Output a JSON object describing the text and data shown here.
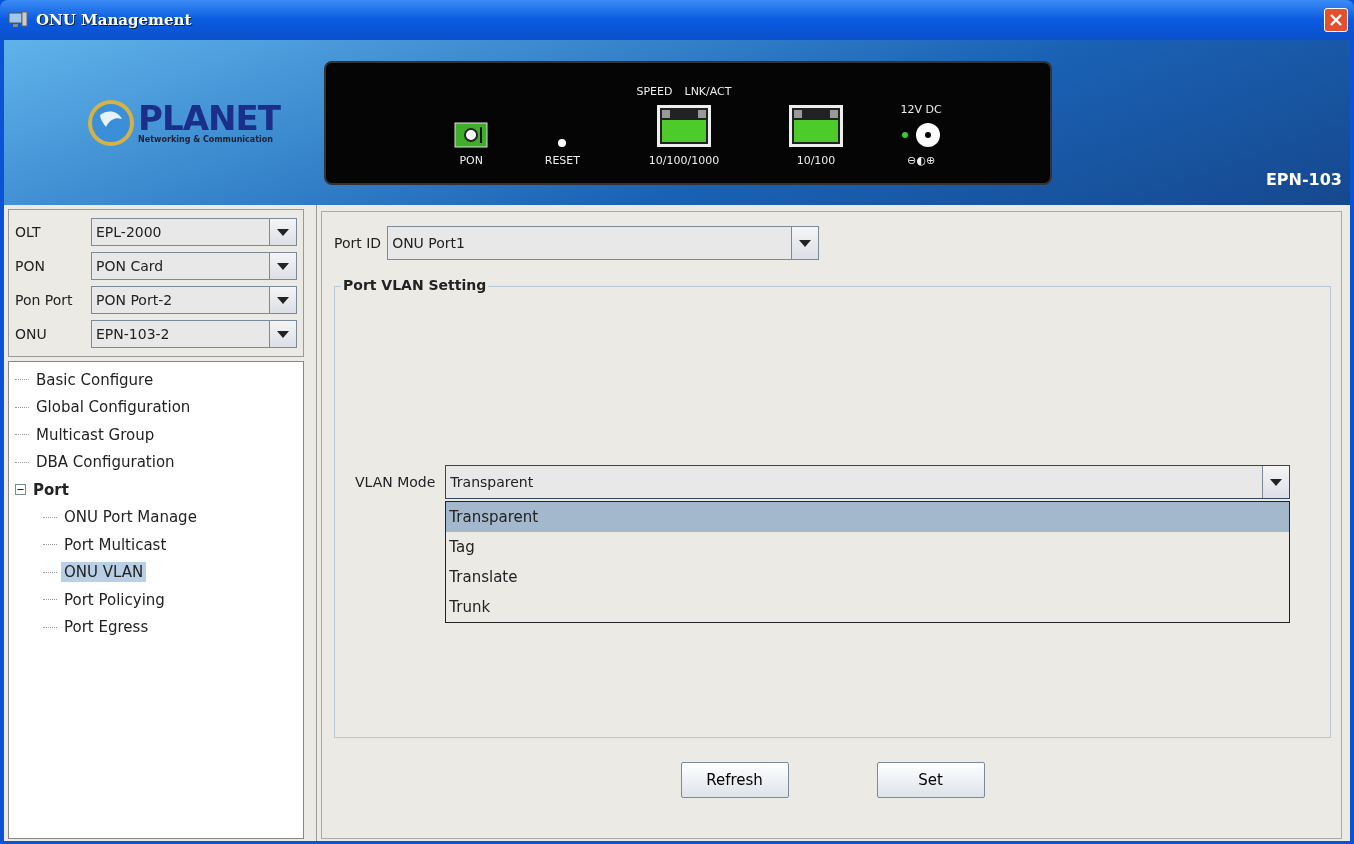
{
  "window": {
    "title": "ONU Management"
  },
  "header": {
    "logo": {
      "name": "PLANET",
      "tagline": "Networking & Communication"
    },
    "model": "EPN-103",
    "device_panel": {
      "pon": "PON",
      "reset": "RESET",
      "speed": "SPEED",
      "lnk_act": "LNK/ACT",
      "port_1": "10/100/1000",
      "port_2": "10/100",
      "power": "12V DC",
      "polarity": "⊖◐⊕"
    }
  },
  "selectors": [
    {
      "label": "OLT",
      "value": "EPL-2000"
    },
    {
      "label": "PON",
      "value": "PON Card"
    },
    {
      "label": "Pon Port",
      "value": "PON Port-2"
    },
    {
      "label": "ONU",
      "value": "EPN-103-2"
    }
  ],
  "tree": [
    {
      "label": "Basic Configure",
      "selected": false
    },
    {
      "label": "Global Configuration",
      "selected": false
    },
    {
      "label": "Multicast Group",
      "selected": false
    },
    {
      "label": "DBA Configuration",
      "selected": false
    },
    {
      "label": "Port",
      "selected": false,
      "expanded": true,
      "children": [
        {
          "label": "ONU Port Manage",
          "selected": false
        },
        {
          "label": "Port Multicast",
          "selected": false
        },
        {
          "label": "ONU VLAN",
          "selected": true
        },
        {
          "label": "Port Policying",
          "selected": false
        },
        {
          "label": "Port Egress",
          "selected": false
        }
      ]
    }
  ],
  "port_id": {
    "label": "Port ID",
    "value": "ONU Port1"
  },
  "vlan_group": {
    "title": "Port VLAN Setting",
    "mode_label": "VLAN Mode",
    "mode_value": "Transparent",
    "expanded": true,
    "options": [
      {
        "label": "Transparent",
        "selected": true
      },
      {
        "label": "Tag",
        "selected": false
      },
      {
        "label": "Translate",
        "selected": false
      },
      {
        "label": "Trunk",
        "selected": false
      }
    ]
  },
  "buttons": [
    "Refresh",
    "Set"
  ]
}
